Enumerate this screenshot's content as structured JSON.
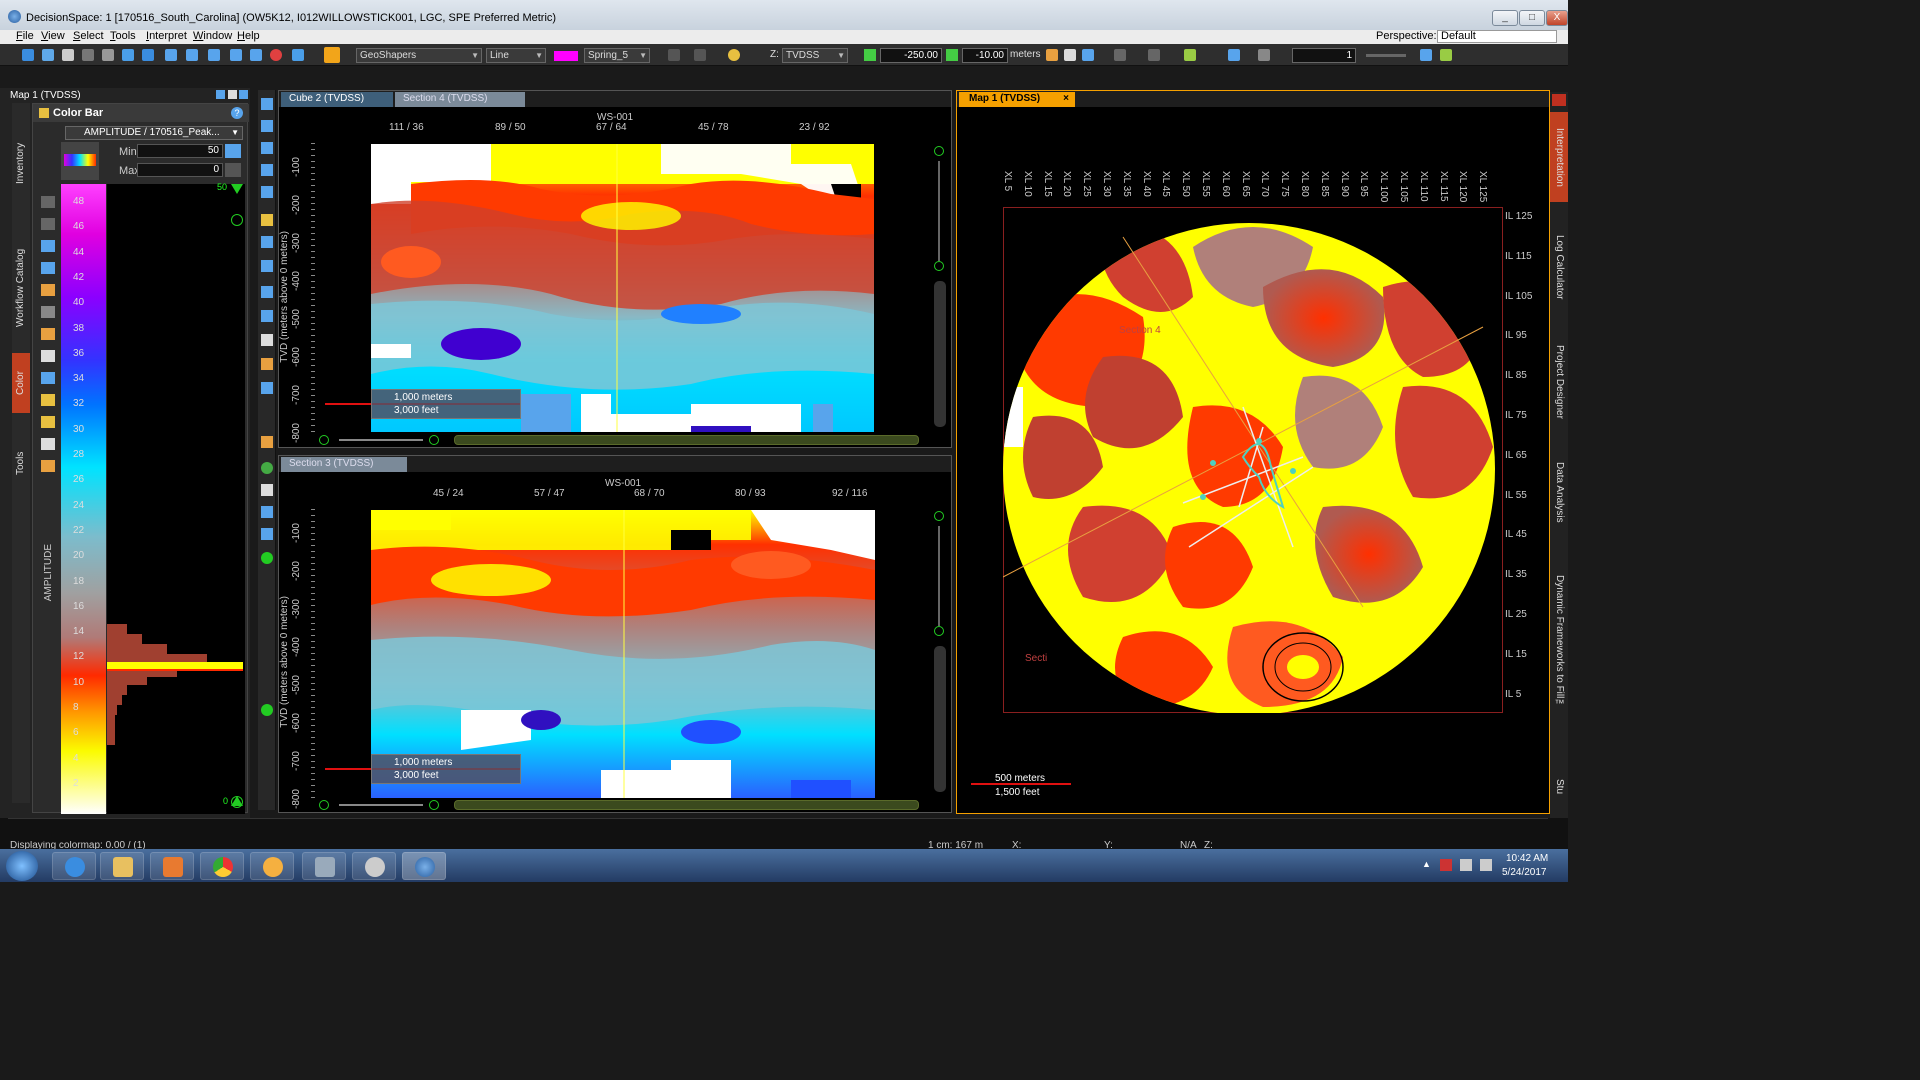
{
  "window": {
    "title": "DecisionSpace: 1 [170516_South_Carolina] (OW5K12, I012WILLOWSTICK001, LGC, SPE Preferred Metric)",
    "min_label": "_",
    "max_label": "□",
    "close_label": "X"
  },
  "menu": {
    "items": [
      "File",
      "View",
      "Select",
      "Tools",
      "Interpret",
      "Window",
      "Help"
    ],
    "perspective_label": "Perspective:",
    "perspective_value": "Default"
  },
  "toolbar": {
    "geoshaper_select": "GeoShapers",
    "line_select": "Line",
    "colormap_select": "Spring_5",
    "z_label": "Z:",
    "z_domain_select": "TVDSS",
    "start_value": "-250.00",
    "end_value": "-10.00",
    "unit_label": "meters",
    "step_value": "1",
    "accent_color": "#ff00ff"
  },
  "left_panel": {
    "title": "Map 1 (TVDSS)",
    "vertical_tabs": [
      "Inventory",
      "Workflow Catalog",
      "Color",
      "Tools"
    ],
    "colorbar_title": "Color Bar",
    "attribute_select": "AMPLITUDE / 170516_Peak...",
    "min_label": "Min",
    "min_value": "50",
    "max_label": "Max",
    "max_value": "0",
    "top_marker": "50",
    "bottom_marker": "0",
    "axis_label": "AMPLITUDE",
    "ticks": [
      "48",
      "46",
      "44",
      "42",
      "40",
      "38",
      "36",
      "34",
      "32",
      "30",
      "28",
      "26",
      "24",
      "22",
      "20",
      "18",
      "16",
      "14",
      "12",
      "10",
      "8",
      "6",
      "4",
      "2"
    ]
  },
  "cube2": {
    "tab_active": "Cube 2 (TVDSS)",
    "tab_inactive": "Section 4 (TVDSS)",
    "well_label": "WS-001",
    "x_ticks": [
      "111 / 36",
      "89 / 50",
      "67 / 64",
      "45 / 78",
      "23 / 92"
    ],
    "y_label": "TVD (meters above 0 meters)",
    "y_ticks": [
      "-100",
      "-200",
      "-300",
      "-400",
      "-500",
      "-600",
      "-700",
      "-800"
    ],
    "scale_m": "1,000 meters",
    "scale_ft": "3,000 feet"
  },
  "section3": {
    "tab": "Section 3 (TVDSS)",
    "well_label": "WS-001",
    "x_ticks": [
      "45 / 24",
      "57 / 47",
      "68 / 70",
      "80 / 93",
      "92 / 116"
    ],
    "y_label": "TVD (meters above 0 meters)",
    "y_ticks": [
      "-100",
      "-200",
      "-300",
      "-400",
      "-500",
      "-600",
      "-700",
      "-800"
    ],
    "scale_m": "1,000 meters",
    "scale_ft": "3,000 feet"
  },
  "map1": {
    "tab": "Map 1 (TVDSS)",
    "xl_ticks": [
      "XL 5",
      "XL 10",
      "XL 15",
      "XL 20",
      "XL 25",
      "XL 30",
      "XL 35",
      "XL 40",
      "XL 45",
      "XL 50",
      "XL 55",
      "XL 60",
      "XL 65",
      "XL 70",
      "XL 75",
      "XL 80",
      "XL 85",
      "XL 90",
      "XL 95",
      "XL 100",
      "XL 105",
      "XL 110",
      "XL 115",
      "XL 120",
      "XL 125"
    ],
    "il_ticks": [
      "IL 125",
      "IL 115",
      "IL 105",
      "IL 95",
      "IL 85",
      "IL 75",
      "IL 65",
      "IL 55",
      "IL 45",
      "IL 35",
      "IL 25",
      "IL 15",
      "IL 5"
    ],
    "section4_label": "Section 4",
    "section_label": "Secti",
    "scale_m": "500 meters",
    "scale_ft": "1,500 feet"
  },
  "right_tabs": [
    "Interpretation",
    "Log Calculator",
    "Project Designer",
    "Data Analysis",
    "Dynamic Frameworks to Fill™",
    "Stu"
  ],
  "status": {
    "left": "Displaying colormap: 0.00 / (1)",
    "mid1": "1 cm: 167 m",
    "mid2": "X:",
    "mid3": "Y:",
    "mid4": "N/A",
    "mid5": "Z:"
  },
  "taskbar": {
    "time": "10:42 AM",
    "date": "5/24/2017"
  }
}
